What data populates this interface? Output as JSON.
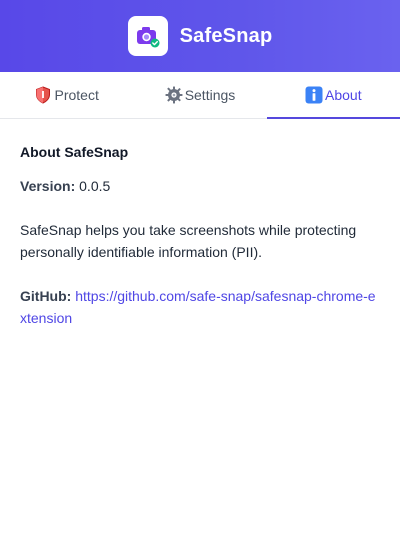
{
  "app": {
    "name": "SafeSnap",
    "logo_icon": "camera-shield-icon",
    "accent_color": "#5848e8"
  },
  "tabs": [
    {
      "label": "Protect",
      "icon": "shield-icon",
      "active": false
    },
    {
      "label": "Settings",
      "icon": "gear-icon",
      "active": false
    },
    {
      "label": "About",
      "icon": "info-icon",
      "active": true
    }
  ],
  "about": {
    "title": "About SafeSnap",
    "version_label": "Version:",
    "version_value": "0.0.5",
    "description": "SafeSnap helps you take screenshots while protecting personally identifiable information (PII).",
    "github_label": "GitHub:",
    "github_url": "https://github.com/safe-snap/safesnap-chrome-extension"
  }
}
